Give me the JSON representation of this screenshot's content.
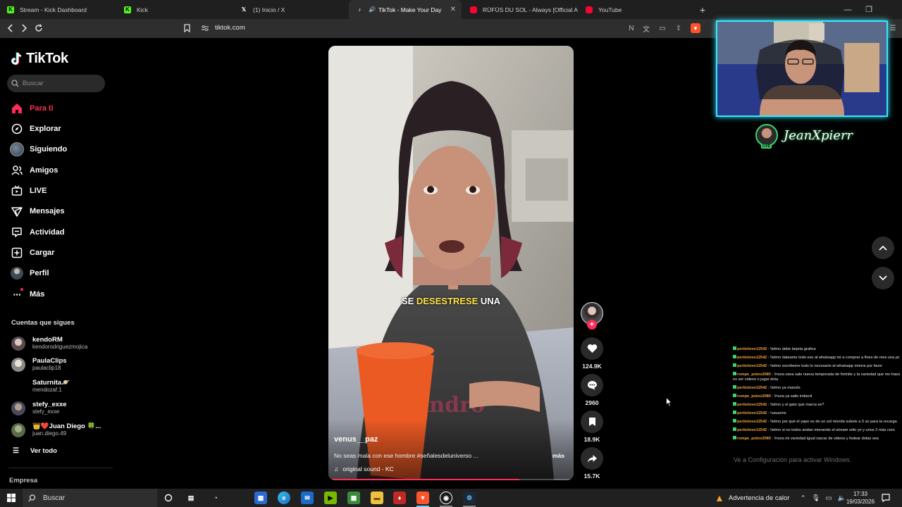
{
  "browser": {
    "tabs": [
      {
        "title": "Stream - Kick Dashboard",
        "icon": "kick-icon",
        "color": "#53fc18"
      },
      {
        "title": "Kick",
        "icon": "kick-icon",
        "color": "#53fc18"
      },
      {
        "title": "(1) Inicio / X",
        "icon": "x-icon",
        "color": "#ffffff"
      },
      {
        "title": "TikTok - Make Your Day",
        "icon": "tiktok-icon",
        "color": "#ffffff",
        "active": true
      },
      {
        "title": "RÜFÜS DU SOL - Always [Official Au",
        "icon": "youtube-icon",
        "color": "#ff0033"
      },
      {
        "title": "YouTube",
        "icon": "youtube-icon",
        "color": "#ff0033"
      }
    ],
    "new_tab": "+",
    "url": "tiktok.com"
  },
  "sidebar": {
    "logo_text": "TikTok",
    "search_placeholder": "Buscar",
    "nav": [
      {
        "label": "Para ti",
        "icon": "home-icon",
        "active": true
      },
      {
        "label": "Explorar",
        "icon": "compass-icon"
      },
      {
        "label": "Siguiendo",
        "icon": "following-avatar-icon"
      },
      {
        "label": "Amigos",
        "icon": "friends-icon"
      },
      {
        "label": "LIVE",
        "icon": "live-icon"
      },
      {
        "label": "Mensajes",
        "icon": "send-icon"
      },
      {
        "label": "Actividad",
        "icon": "activity-icon"
      },
      {
        "label": "Cargar",
        "icon": "upload-icon"
      },
      {
        "label": "Perfil",
        "icon": "profile-icon"
      },
      {
        "label": "Más",
        "icon": "more-icon"
      }
    ],
    "following_title": "Cuentas que sigues",
    "accounts": [
      {
        "name": "kendoRM",
        "handle": "kendorodriguezmojica"
      },
      {
        "name": "PaulaClips",
        "handle": "paulaclip18"
      },
      {
        "name": "Saturnita🪐",
        "handle": "mendozaf.1"
      },
      {
        "name": "stefy_exxe",
        "handle": "stefy_exxe"
      },
      {
        "name": "👑❤️Juan Diego 🍀...",
        "handle": "juan.diego.49"
      }
    ],
    "see_all": "Ver todo",
    "company": "Empresa"
  },
  "video": {
    "caption_overlay_prefix": "SE ",
    "caption_overlay_highlight": "DESESTRESE",
    "caption_overlay_suffix": " UNA",
    "author": "venus__paz",
    "description": "No seas mala con ese hombre #señalesdeluniverso ...",
    "more": "más",
    "sound": "original sound - KC",
    "progress_fraction": 0.78
  },
  "actions": {
    "likes": "124.9K",
    "comments": "2960",
    "saves": "18.9K",
    "shares": "15.7K"
  },
  "stream_overlay": {
    "streamer_name": "JeanXpierr",
    "live_badge": "LIVE",
    "chat": [
      {
        "user": "peritolove12542",
        "text": "!telmo debe tarjeta grafica"
      },
      {
        "user": "peritolove12542",
        "text": "!telmo dateame todo eso al whatsapp iré a comprar a fines de mes una pc"
      },
      {
        "user": "peritolove12542",
        "text": "!telmo escribeme todo lo necesario al whatsapp mierra por favor"
      },
      {
        "user": "rompe_potos3080",
        "text": "!mura osea sale nueva temporada de fortnite y la variedad que me traes es ver videos o jugar dota"
      },
      {
        "user": "peritolove12542",
        "text": "!telmo ya manolo"
      },
      {
        "user": "rompe_potos3080",
        "text": "!mura ya salio imbecil"
      },
      {
        "user": "peritolove12542",
        "text": "!telmo y el gato que marca es?"
      },
      {
        "user": "peritolove12542",
        "text": "!usuarios"
      },
      {
        "user": "peritolove12542",
        "text": "!telmo por qué el yape es de un sol mierda subele a 5 so para la recarga"
      },
      {
        "user": "peritolove12542",
        "text": "!telmo si no todos andan mierando el stream sólo yo y unos 2 más creo"
      },
      {
        "user": "rompe_potos3080",
        "text": "!mura mi variedad igual rascar de videos y fedear dotas sea"
      }
    ],
    "windows_activation": "Ve a Configuración para activar Windows."
  },
  "taskbar": {
    "search_placeholder": "Buscar",
    "weather": "Advertencia de calor",
    "time": "17:33",
    "date": "19/03/2026"
  }
}
